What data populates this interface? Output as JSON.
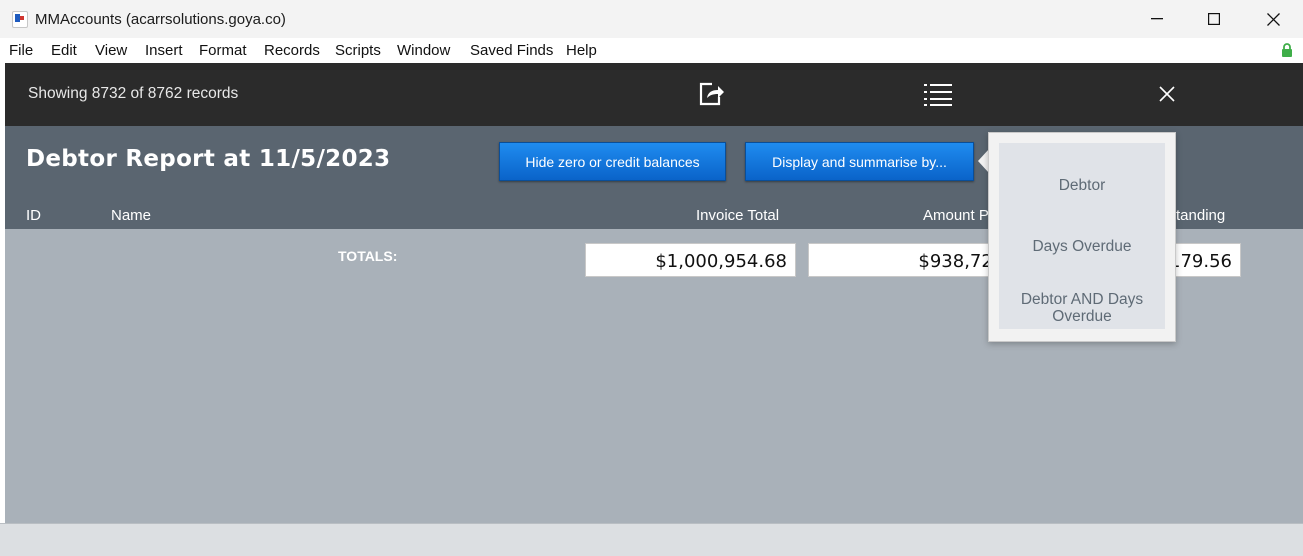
{
  "window": {
    "title": "MMAccounts (acarrsolutions.goya.co)",
    "controls": [
      "minimize",
      "maximize",
      "close"
    ]
  },
  "menu": [
    "File",
    "Edit",
    "View",
    "Insert",
    "Format",
    "Records",
    "Scripts",
    "Window",
    "Saved Finds",
    "Help"
  ],
  "toolbar": {
    "record_count": "Showing 8732 of 8762 records",
    "icons": [
      "share-icon",
      "list-icon",
      "close-icon"
    ]
  },
  "report": {
    "title": "Debtor Report at 11/5/2023",
    "hide_zero_button": "Hide zero or credit balances",
    "display_button": "Display and summarise by..."
  },
  "columns": {
    "id": "ID",
    "name": "Name",
    "invoice_total": "Invoice Total",
    "amount_paid": "Amount P",
    "outstanding": "tanding"
  },
  "totals": {
    "label": "TOTALS:",
    "invoice_total": "$1,000,954.68",
    "amount_paid": "$938,725.",
    "outstanding": "179.56"
  },
  "popover": {
    "options": [
      "Debtor",
      "Days Overdue",
      "Debtor AND Days Overdue"
    ]
  },
  "colors": {
    "toolbar": "#2b2b2b",
    "header": "#5a6570",
    "body": "#a9b1b9",
    "button_blue": "#0a63c9",
    "lock": "#3fae49"
  }
}
